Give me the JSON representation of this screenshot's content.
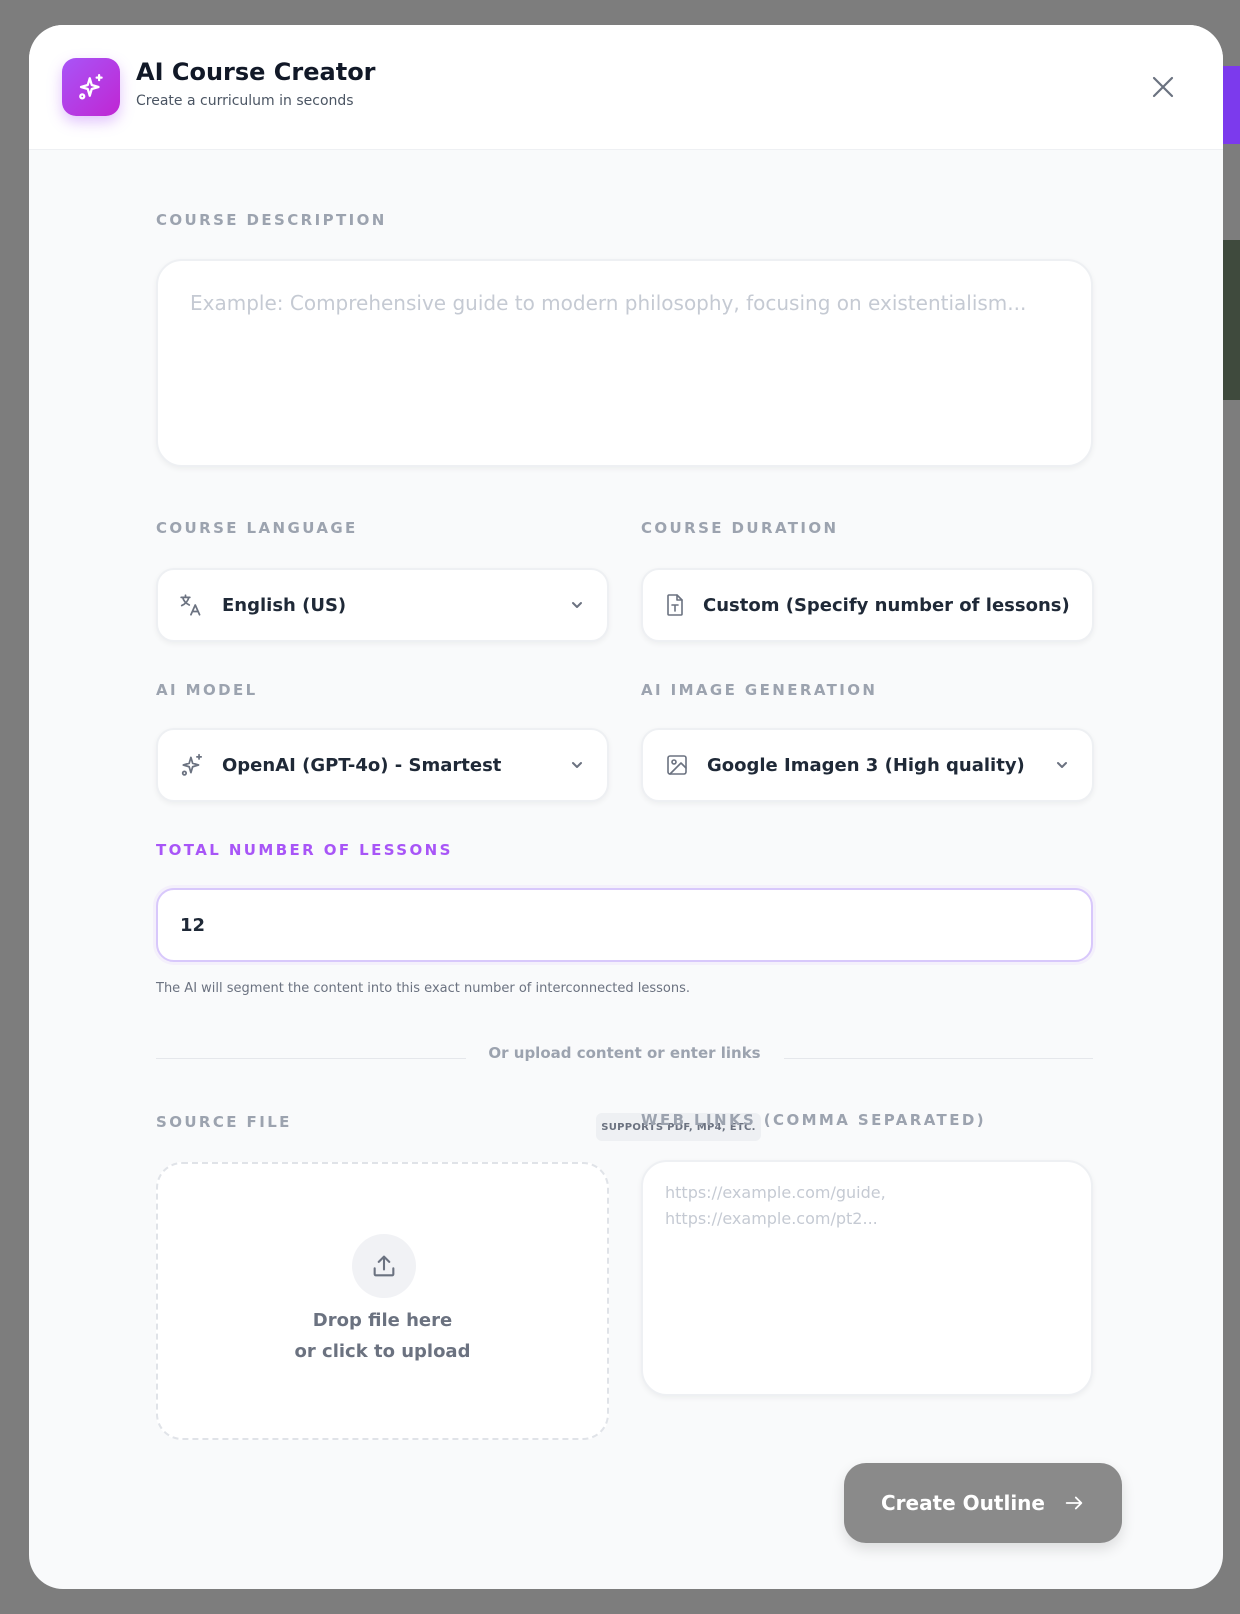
{
  "header": {
    "title": "AI Course Creator",
    "subtitle": "Create a curriculum in seconds"
  },
  "description": {
    "label": "COURSE DESCRIPTION",
    "placeholder": "Example: Comprehensive guide to modern philosophy, focusing on existentialism..."
  },
  "language": {
    "label": "COURSE LANGUAGE",
    "value": "English (US)",
    "icon": "translate-icon"
  },
  "duration": {
    "label": "COURSE DURATION",
    "value": "Custom (Specify number of lessons)",
    "icon": "document-text-icon"
  },
  "model": {
    "label": "AI MODEL",
    "value": "OpenAI (GPT-4o) - Smartest",
    "icon": "sparkles-icon"
  },
  "image_gen": {
    "label": "AI IMAGE GENERATION",
    "value": "Google Imagen 3 (High quality)",
    "icon": "image-icon"
  },
  "lessons": {
    "label": "TOTAL NUMBER OF LESSONS",
    "value": "12",
    "hint": "The AI will segment the content into this exact number of interconnected lessons."
  },
  "divider": {
    "text": "Or upload content or enter links"
  },
  "source_file": {
    "label": "SOURCE FILE",
    "badge": "SUPPORTS PDF, MP4, ETC.",
    "drop_line1": "Drop file here",
    "drop_line2": "or click to upload"
  },
  "web_links": {
    "label": "WEB LINKS (COMMA SEPARATED)",
    "placeholder": "https://example.com/guide,\nhttps://example.com/pt2..."
  },
  "actions": {
    "create_label": "Create Outline"
  },
  "colors": {
    "accent": "#a855f7",
    "backdrop": "#7d7d7d",
    "button_disabled": "#8a8a8a"
  }
}
